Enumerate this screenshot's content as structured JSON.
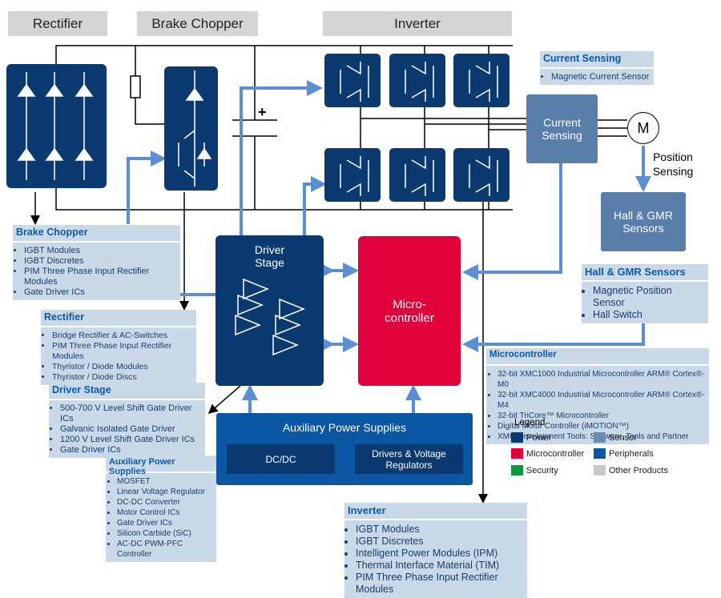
{
  "headers": {
    "rectifier": "Rectifier",
    "brake_chopper": "Brake Chopper",
    "inverter": "Inverter"
  },
  "blocks": {
    "current_sensing": "Current Sensing",
    "motor": "M",
    "position_sensing": "Position Sensing",
    "hall_gmr": "Hall & GMR Sensors",
    "driver_stage": "Driver Stage",
    "microcontroller": "Micro-controller",
    "aux_power": "Auxiliary Power Supplies",
    "dcdc": "DC/DC",
    "drivers_regulators": "Drivers & Voltage Regulators",
    "plus": "+"
  },
  "info": {
    "current_sensing": {
      "title": "Current Sensing",
      "items": [
        "Magnetic Current Sensor"
      ]
    },
    "brake_chopper": {
      "title": "Brake Chopper",
      "items": [
        "IGBT Modules",
        "IGBT Discretes",
        "PIM Three Phase Input Rectifier Modules",
        "Gate Driver ICs"
      ]
    },
    "rectifier": {
      "title": "Rectifier",
      "items": [
        "Bridge Rectifier & AC-Switches",
        "PIM Three Phase Input Rectifier Modules",
        "Thyristor / Diode Modules",
        "Thyristor / Diode Discs"
      ]
    },
    "driver_stage": {
      "title": "Driver Stage",
      "items": [
        "500-700 V Level Shift Gate Driver ICs",
        "Galvanic Isolated Gate Driver",
        "1200 V Level Shift Gate Driver ICs",
        "Gate Driver ICs"
      ]
    },
    "aux_power": {
      "title": "Auxiliary Power Supplies",
      "items": [
        "MOSFET",
        "Linear Voltage Regulator",
        "DC-DC Converter",
        "Motor Control ICs",
        "Gate Driver ICs",
        "Silicon Carbide (SiC)",
        "AC-DC PWM-PFC Controller"
      ]
    },
    "hall_gmr": {
      "title": "Hall & GMR Sensors",
      "items": [
        "Magnetic Position Sensor",
        "Hall Switch"
      ]
    },
    "microcontroller": {
      "title": "Microcontroller",
      "items": [
        "32-bit XMC1000 Industrial Microcontroller ARM® Cortex®-M0",
        "32-bit XMC4000 Industrial Microcontroller ARM® Cortex®-M4",
        "32-bit TriCore™ Microcontroller",
        "Digital Motor Controller (iMOTION™)",
        "XMC Development Tools: Software, Tools and Partner"
      ]
    },
    "inverter": {
      "title": "Inverter",
      "items": [
        "IGBT Modules",
        "IGBT Discretes",
        "Intelligent Power Modules (IPM)",
        "Thermal Interface Material (TIM)",
        "PIM Three Phase Input Rectifier Modules"
      ]
    }
  },
  "legend": {
    "title": "Legend",
    "items": [
      {
        "label": "Power",
        "color": "#0a3a70"
      },
      {
        "label": "Sensor",
        "color": "#6a8db0"
      },
      {
        "label": "Microcontroller",
        "color": "#e0003c"
      },
      {
        "label": "Peripherals",
        "color": "#0b57a4"
      },
      {
        "label": "Security",
        "color": "#0a9a3c"
      },
      {
        "label": "Other Products",
        "color": "#c8c8c8"
      }
    ]
  }
}
